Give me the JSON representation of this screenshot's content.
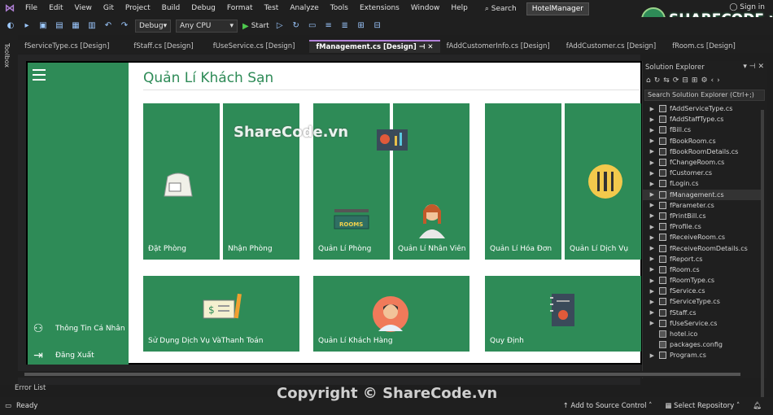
{
  "menubar": {
    "items": [
      "File",
      "Edit",
      "View",
      "Git",
      "Project",
      "Build",
      "Debug",
      "Format",
      "Test",
      "Analyze",
      "Tools",
      "Extensions",
      "Window",
      "Help"
    ],
    "search_label": "Search",
    "project_name": "HotelManager",
    "sign_in": "Sign in"
  },
  "toolbar": {
    "config": "Debug",
    "platform": "Any CPU",
    "start_label": "Start"
  },
  "toolbox_label": "Toolbox",
  "doc_tabs": [
    "fServiceType.cs [Design]",
    "fStaff.cs [Design]",
    "fUseService.cs [Design]",
    "fManagement.cs [Design]",
    "fAddCustomerInfo.cs [Design]",
    "fAddCustomer.cs [Design]",
    "fRoom.cs [Design]"
  ],
  "form": {
    "title": "Quản Lí Khách Sạn",
    "side": {
      "profile_label": "Thông Tin Cá Nhân",
      "logout_label": "Đăng Xuất"
    },
    "tiles": {
      "book_room": "Đặt Phòng",
      "receive_room": "Nhận Phòng",
      "manage_room": "Quản Lí Phòng",
      "manage_staff": "Quản Lí Nhân Viên",
      "manage_bill": "Quản Lí Hóa Đơn",
      "manage_service": "Quản Lí Dịch Vụ",
      "use_service": "Sử Dụng Dịch Vụ VàThanh Toán",
      "manage_customer": "Quản Lí Khách Hàng",
      "rules": "Quy Định",
      "rooms_sign": "ROOMS"
    },
    "colors": {
      "accent": "#2e8b57"
    }
  },
  "solution_explorer": {
    "title": "Solution Explorer",
    "search_placeholder": "Search Solution Explorer (Ctrl+;)",
    "items": [
      "fAddServiceType.cs",
      "fAddStaffType.cs",
      "fBill.cs",
      "fBookRoom.cs",
      "fBookRoomDetails.cs",
      "fChangeRoom.cs",
      "fCustomer.cs",
      "fLogin.cs",
      "fManagement.cs",
      "fParameter.cs",
      "fPrintBill.cs",
      "fProfile.cs",
      "fReceiveRoom.cs",
      "fReceiveRoomDetails.cs",
      "fReport.cs",
      "fRoom.cs",
      "fRoomType.cs",
      "fService.cs",
      "fServiceType.cs",
      "fStaff.cs",
      "fUseService.cs",
      "hotel.ico",
      "packages.config",
      "Program.cs"
    ],
    "selected": "fManagement.cs"
  },
  "bottom": {
    "error_list": "Error List",
    "status": "Ready",
    "add_source_control": "Add to Source Control",
    "select_repository": "Select Repository"
  },
  "overlay": {
    "watermark": "ShareCode.vn",
    "copyright": "Copyright © ShareCode.vn",
    "logo": "SHARECODE.vn"
  }
}
